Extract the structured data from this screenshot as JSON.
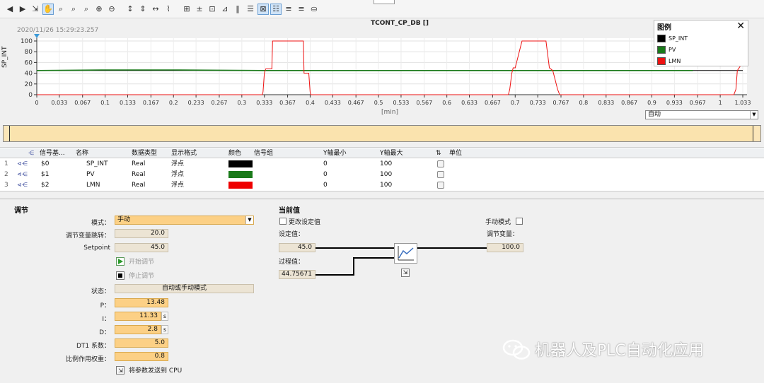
{
  "toolbar": {
    "buttons": [
      "back",
      "forward",
      "pin",
      "hand",
      "zoom-rect",
      "zoom-x",
      "zoom-y",
      "zoom-in",
      "zoom-out",
      "fit-y",
      "fit-x-y",
      "fit-x",
      "chart",
      "measure",
      "measure-2",
      "cursor",
      "cursor-2",
      "split-v",
      "split-h",
      "pointer",
      "legend",
      "align-left",
      "align-right",
      "export"
    ]
  },
  "chart": {
    "timestamp": "2020/11/26 15:29:23.257",
    "title": "TCONT_CP_DB []",
    "ylabel": "SP_INT",
    "xlabel": "[min]",
    "mode_select": "自动",
    "legend": {
      "title": "图例",
      "items": [
        {
          "label": "SP_INT",
          "color": "#000000"
        },
        {
          "label": "PV",
          "color": "#1a7a1a"
        },
        {
          "label": "LMN",
          "color": "#ee1111"
        }
      ]
    }
  },
  "chart_data": {
    "type": "line",
    "title": "TCONT_CP_DB []",
    "xlabel": "[min]",
    "ylabel": "SP_INT",
    "xlim": [
      0,
      1.033
    ],
    "ylim": [
      0,
      100
    ],
    "x_ticks": [
      "0",
      "0.033",
      "0.067",
      "0.1",
      "0.133",
      "0.167",
      "0.2",
      "0.233",
      "0.267",
      "0.3",
      "0.333",
      "0.367",
      "0.4",
      "0.433",
      "0.467",
      "0.5",
      "0.533",
      "0.567",
      "0.6",
      "0.633",
      "0.667",
      "0.7",
      "0.733",
      "0.767",
      "0.8",
      "0.833",
      "0.867",
      "0.9",
      "0.933",
      "0.967",
      "1",
      "1.033"
    ],
    "y_ticks": [
      "0",
      "20",
      "40",
      "60",
      "80",
      "100"
    ],
    "grid": true,
    "legend_position": "top-right",
    "series": [
      {
        "name": "SP_INT",
        "color": "#000000",
        "points": [
          [
            0,
            45
          ],
          [
            1.033,
            45
          ]
        ]
      },
      {
        "name": "PV",
        "color": "#1a7a1a",
        "points": [
          [
            0,
            45
          ],
          [
            0.095,
            46
          ],
          [
            0.2,
            46
          ],
          [
            0.333,
            45
          ],
          [
            0.4,
            45
          ],
          [
            0.46,
            45
          ],
          [
            0.625,
            45
          ],
          [
            0.7,
            45
          ],
          [
            0.76,
            45
          ],
          [
            0.96,
            45
          ]
        ]
      },
      {
        "name": "LMN",
        "color": "#ee1111",
        "points": [
          [
            0,
            0
          ],
          [
            0.33,
            0
          ],
          [
            0.331,
            5
          ],
          [
            0.333,
            40
          ],
          [
            0.335,
            48
          ],
          [
            0.344,
            48
          ],
          [
            0.345,
            100
          ],
          [
            0.39,
            100
          ],
          [
            0.391,
            40
          ],
          [
            0.398,
            40
          ],
          [
            0.4,
            5
          ],
          [
            0.401,
            0
          ],
          [
            0.69,
            0
          ],
          [
            0.692,
            10
          ],
          [
            0.695,
            40
          ],
          [
            0.697,
            50
          ],
          [
            0.7,
            50
          ],
          [
            0.71,
            100
          ],
          [
            0.745,
            100
          ],
          [
            0.75,
            50
          ],
          [
            0.755,
            45
          ],
          [
            0.762,
            10
          ],
          [
            0.765,
            0
          ],
          [
            1.02,
            0
          ],
          [
            1.023,
            10
          ],
          [
            1.025,
            45
          ],
          [
            1.033,
            60
          ]
        ]
      }
    ]
  },
  "table": {
    "headers": {
      "sig_base": "信号基...",
      "name": "名称",
      "dtype": "数据类型",
      "fmt": "显示格式",
      "color": "颜色",
      "group": "信号组",
      "ymin": "Y轴最小",
      "ymax": "Y轴最大",
      "unit": "单位"
    },
    "rows": [
      {
        "num": "1",
        "sig": "$0",
        "name": "SP_INT",
        "dtype": "Real",
        "fmt": "浮点",
        "color": "#000000",
        "ymin": "0",
        "ymax": "100"
      },
      {
        "num": "2",
        "sig": "$1",
        "name": "PV",
        "dtype": "Real",
        "fmt": "浮点",
        "color": "#1a7a1a",
        "ymin": "0",
        "ymax": "100"
      },
      {
        "num": "3",
        "sig": "$2",
        "name": "LMN",
        "dtype": "Real",
        "fmt": "浮点",
        "color": "#ee0000",
        "ymin": "0",
        "ymax": "100"
      }
    ]
  },
  "tuning": {
    "title": "调节",
    "mode_label": "模式：",
    "mode_value": "手动",
    "jump_label": "调节变量跳转：",
    "jump_value": "20.0",
    "setpoint_label": "Setpoint",
    "setpoint_value": "45.0",
    "start_label": "开始调节",
    "stop_label": "停止调节",
    "state_label": "状态：",
    "state_value": "自动或手动模式",
    "p_label": "P：",
    "p_value": "13.48",
    "i_label": "I：",
    "i_value": "11.33",
    "i_unit": "s",
    "d_label": "D：",
    "d_value": "2.8",
    "d_unit": "s",
    "dt1_label": "DT1 系数：",
    "dt1_value": "5.0",
    "weight_label": "比例作用权重：",
    "weight_value": "0.8",
    "send_label": "将参数发送到 CPU"
  },
  "current": {
    "title": "当前值",
    "change_sp_label": "更改设定值",
    "sp_label": "设定值：",
    "sp_value": "45.0",
    "pv_label": "过程值：",
    "pv_value": "44.75671",
    "manual_label": "手动模式",
    "mv_label": "调节变量：",
    "mv_value": "100.0"
  },
  "watermark": {
    "text": "机器人及PLC自动化应用"
  }
}
